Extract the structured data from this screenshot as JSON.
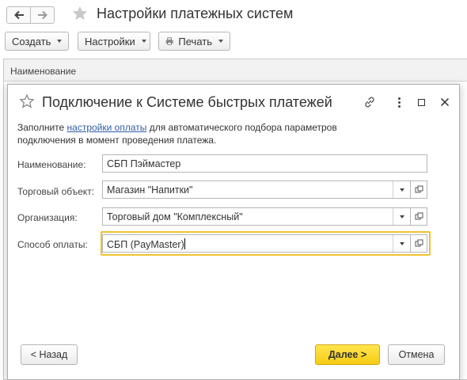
{
  "main_window": {
    "title": "Настройки платежных систем",
    "toolbar": {
      "create_label": "Создать",
      "settings_label": "Настройки",
      "print_label": "Печать"
    },
    "list": {
      "columns": [
        "Наименование"
      ]
    }
  },
  "dialog": {
    "title": "Подключение к Системе быстрых платежей",
    "info": {
      "before_link": "Заполните ",
      "link_text": "настройки оплаты",
      "after_link": " для автоматического подбора параметров подключения в момент проведения платежа."
    },
    "fields": {
      "name": {
        "label": "Наименование:",
        "value": "СБП Пэймастер"
      },
      "trade_object": {
        "label": "Торговый объект:",
        "value": "Магазин \"Напитки\""
      },
      "organization": {
        "label": "Организация:",
        "value": "Торговый дом \"Комплексный\""
      },
      "payment_method": {
        "label": "Способ оплаты:",
        "value": "СБП (PayMaster)"
      }
    },
    "buttons": {
      "back_label": "< Назад",
      "next_label": "Далее >",
      "cancel_label": "Отмена"
    }
  },
  "colors": {
    "accent_yellow": "#f5cc14",
    "focus_border": "#f2c22c",
    "link": "#2f5fa7"
  },
  "icons": [
    "arrow-left-icon",
    "arrow-right-icon",
    "star-icon",
    "printer-icon",
    "link-icon",
    "more-icon",
    "maximize-icon",
    "close-icon",
    "open-form-icon"
  ]
}
